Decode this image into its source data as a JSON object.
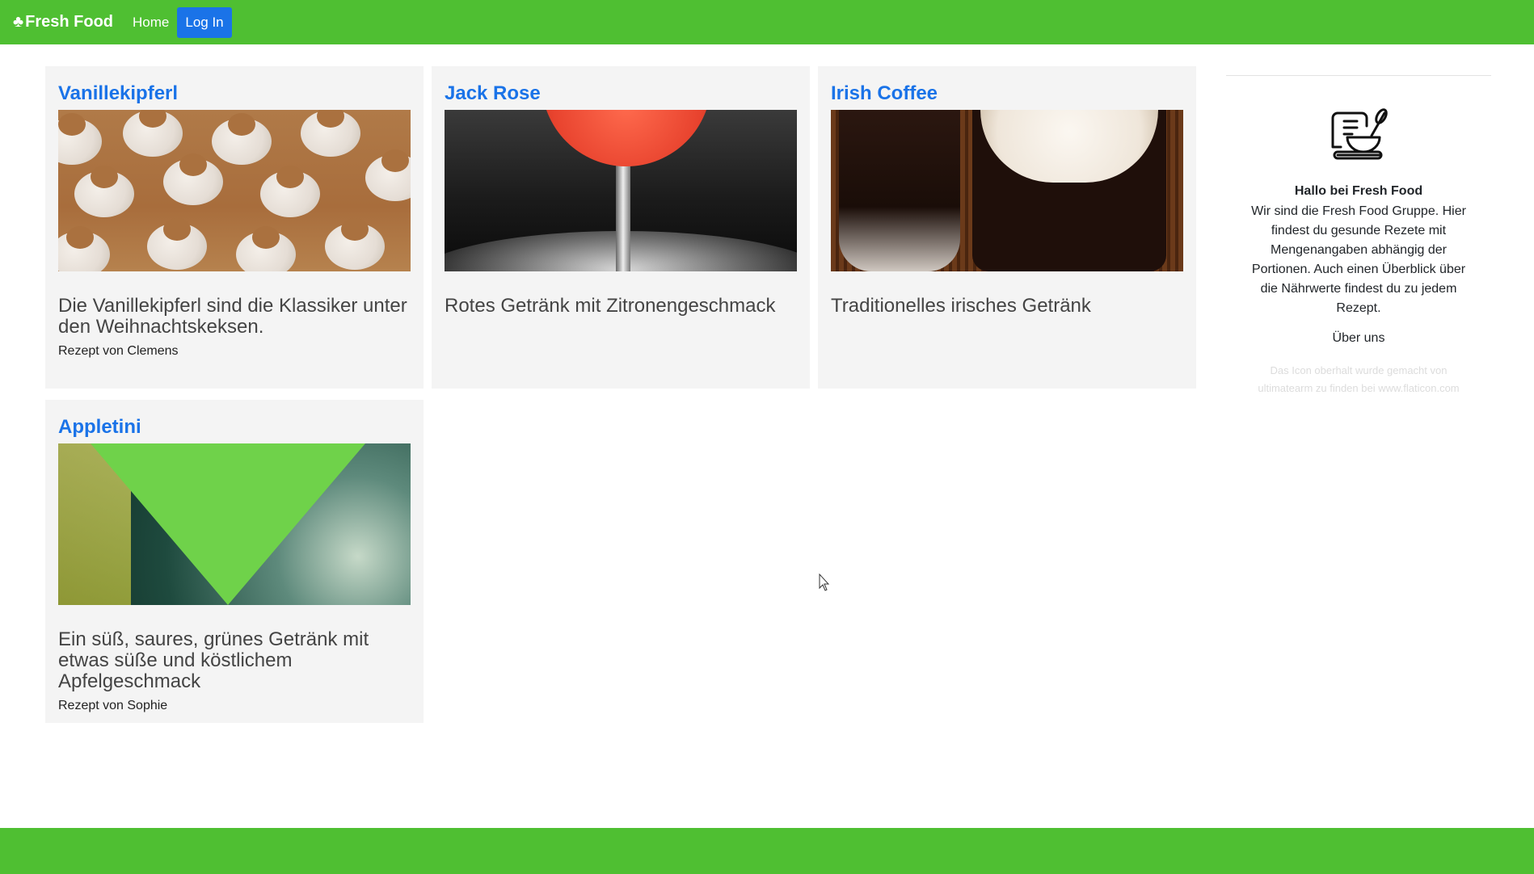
{
  "navbar": {
    "brand": "Fresh Food",
    "home": "Home",
    "login": "Log In"
  },
  "recipes": [
    {
      "title": "Vanillekipferl",
      "description": "Die Vanillekipferl sind die Klassiker unter den Weihnachtskeksen.",
      "author": "Rezept von Clemens"
    },
    {
      "title": "Jack Rose",
      "description": "Rotes Getränk mit Zitronengeschmack",
      "author": ""
    },
    {
      "title": "Irish Coffee",
      "description": "Traditionelles irisches Getränk",
      "author": ""
    },
    {
      "title": "Appletini",
      "description": "Ein süß, saures, grünes Getränk mit etwas süße und köstlichem Apfelgeschmack",
      "author": "Rezept von Sophie"
    }
  ],
  "sidebar": {
    "heading": "Hallo bei Fresh Food",
    "text": "Wir sind die Fresh Food Gruppe. Hier findest du gesunde Rezete mit Mengenangaben abhängig der Portionen. Auch einen Überblick über die Nährwerte findest du zu jedem Rezept.",
    "about": "Über uns",
    "credit": "Das Icon oberhalt wurde gemacht von ultimatearm zu finden bei www.flaticon.com"
  },
  "colors": {
    "green": "#4fbf32",
    "blue": "#1a73e8"
  }
}
